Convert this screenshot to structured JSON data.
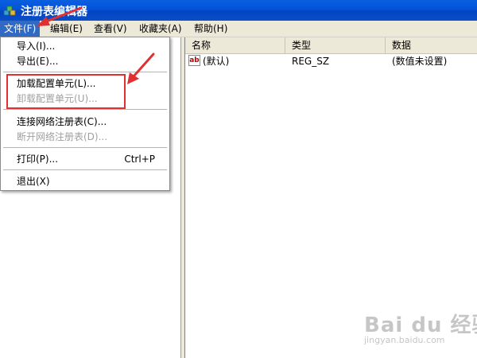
{
  "window": {
    "title": "注册表编辑器",
    "icon": "registry-editor-icon"
  },
  "menubar": {
    "items": [
      {
        "label": "文件(F)",
        "active": true
      },
      {
        "label": "编辑(E)"
      },
      {
        "label": "查看(V)"
      },
      {
        "label": "收藏夹(A)"
      },
      {
        "label": "帮助(H)"
      }
    ]
  },
  "file_menu": {
    "items": [
      {
        "label": "导入(I)...",
        "enabled": true
      },
      {
        "label": "导出(E)...",
        "enabled": true
      },
      {
        "label": "加载配置单元(L)...",
        "enabled": true
      },
      {
        "label": "卸载配置单元(U)...",
        "enabled": false
      },
      {
        "label": "连接网络注册表(C)...",
        "enabled": true
      },
      {
        "label": "断开网络注册表(D)...",
        "enabled": false
      },
      {
        "label": "打印(P)...",
        "shortcut": "Ctrl+P",
        "enabled": true
      },
      {
        "label": "退出(X)",
        "enabled": true
      }
    ]
  },
  "list": {
    "columns": [
      "名称",
      "类型",
      "数据"
    ],
    "rows": [
      {
        "name": "(默认)",
        "type": "REG_SZ",
        "data": "(数值未设置)",
        "icon": "string-value-icon",
        "icon_text": "ab"
      }
    ]
  },
  "annotation": {
    "color": "#e03030"
  },
  "watermark": {
    "brand": "Bai du 经验",
    "sub": "jingyan.baidu.com"
  },
  "colors": {
    "titlebar": "#0352d8",
    "menu_active": "#316ac5",
    "chrome": "#ece9d8"
  }
}
